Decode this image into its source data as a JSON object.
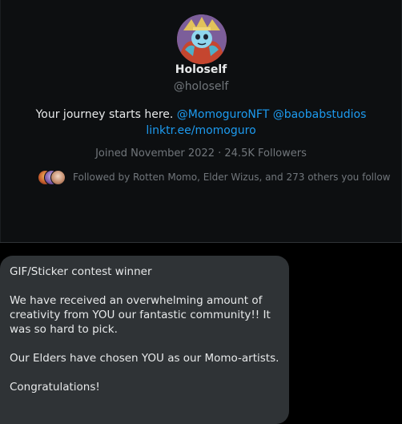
{
  "profile": {
    "display_name": "Holoself",
    "handle": "@holoself",
    "bio_text": "Your journey starts here.",
    "bio_mention_1": "@MomoguroNFT",
    "bio_mention_2": "@baobabstudios",
    "bio_link": "linktr.ee/momoguro",
    "joined": "Joined November 2022",
    "separator": "·",
    "followers": "24.5K Followers",
    "followed_by": "Followed by Rotten Momo, Elder Wizus, and 273 others you follow",
    "avatar_icon": "holoself-avatar"
  },
  "message": {
    "title": "GIF/Sticker contest winner",
    "paragraph_1": "We have received an overwhelming amount of creativity from YOU our fantastic community!! It was so hard to pick.",
    "paragraph_2": "Our Elders have chosen YOU as our Momo-artists.",
    "paragraph_3": "Congratulations!"
  },
  "colors": {
    "background": "#000000",
    "card": "#0d0f11",
    "link": "#1d9bf0",
    "primary_text": "#e7e9ea",
    "secondary_text": "#71767b",
    "bubble": "#2f3336"
  }
}
